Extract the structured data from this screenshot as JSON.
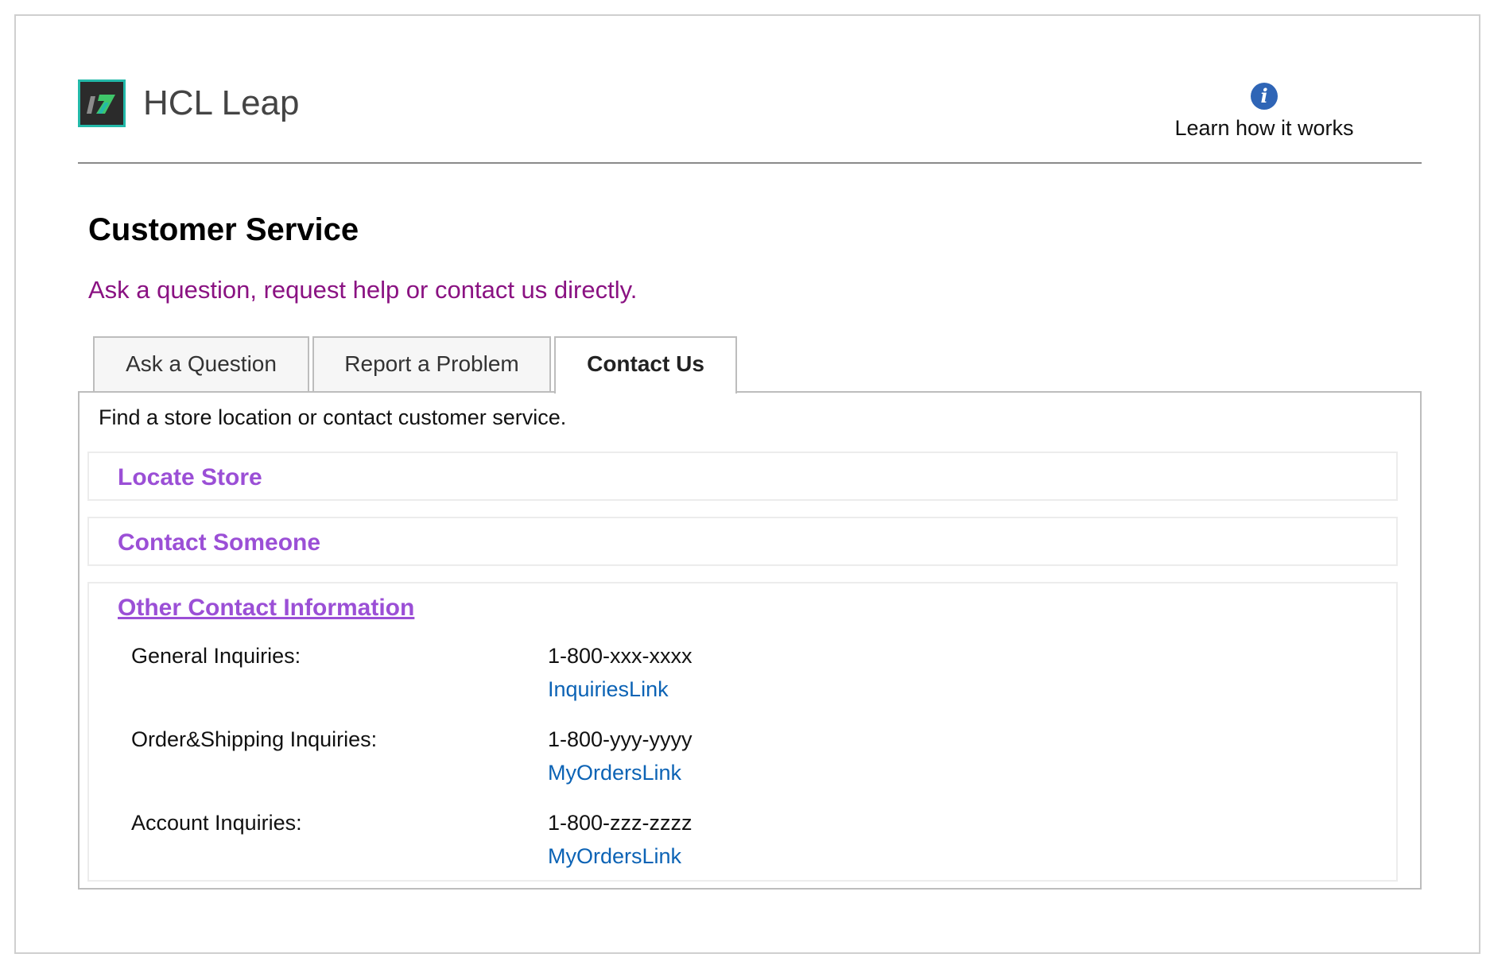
{
  "header": {
    "brand": "HCL Leap",
    "learn_label": "Learn how it works",
    "info_glyph": "i"
  },
  "page": {
    "title": "Customer Service",
    "subtitle": "Ask a question, request help or contact us directly."
  },
  "tabs": [
    {
      "label": "Ask a Question",
      "active": false
    },
    {
      "label": "Report a Problem",
      "active": false
    },
    {
      "label": "Contact Us",
      "active": true
    }
  ],
  "panel": {
    "description": "Find a store location or contact customer service.",
    "sections": [
      {
        "title": "Locate Store",
        "expanded": false
      },
      {
        "title": "Contact Someone",
        "expanded": false
      },
      {
        "title": "Other Contact Information",
        "expanded": true
      }
    ],
    "contacts": [
      {
        "label": "General Inquiries:",
        "phone": "1-800-xxx-xxxx",
        "link": "InquiriesLink"
      },
      {
        "label": "Order&Shipping Inquiries:",
        "phone": "1-800-yyy-yyyy",
        "link": "MyOrdersLink"
      },
      {
        "label": "Account Inquiries:",
        "phone": "1-800-zzz-zzzz",
        "link": "MyOrdersLink"
      }
    ]
  },
  "colors": {
    "subtitle": "#8a1282",
    "section_title": "#9b4fd6",
    "link": "#0c63b5",
    "info_icon": "#2f65b6",
    "logo_accent": "#23b9a9"
  },
  "icons": {
    "logo": "hcl-leap-logo-icon",
    "info": "info-icon"
  }
}
